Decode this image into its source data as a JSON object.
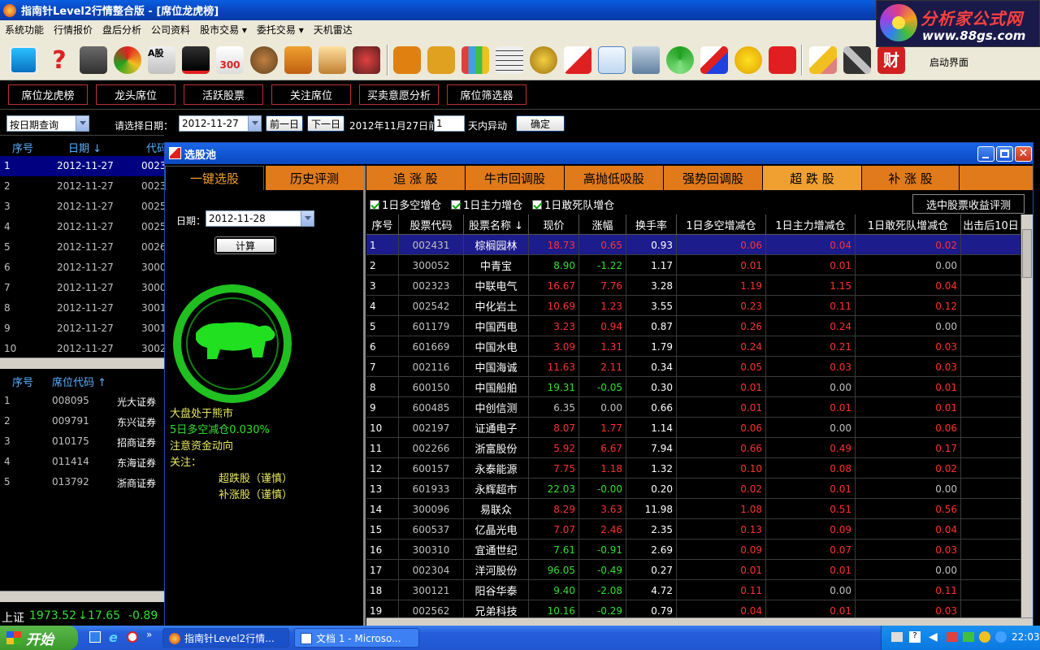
{
  "window_title": "指南针Level2行情整合版 - [席位龙虎榜]",
  "logo": {
    "line1": "分析家公式网",
    "line2": "www.88gs.com"
  },
  "menu": [
    "系统功能",
    "行情报价",
    "盘后分析",
    "公司资料",
    "股市交易 ▾",
    "委托交易 ▾",
    "天机雷达"
  ],
  "toolbar": {
    "start_label": "启动界面"
  },
  "nav_tabs": [
    "席位龙虎榜",
    "龙头席位",
    "活跃股票",
    "关注席位",
    "买卖意愿分析",
    "席位筛选器"
  ],
  "query": {
    "mode": "按日期查询",
    "date_label": "请选择日期：",
    "date": "2012-11-27",
    "prev": "前一日",
    "next": "下一日",
    "before_text": "2012年11月27日前",
    "days": "1",
    "days_suffix": "天内异动",
    "confirm": "确定"
  },
  "left_top": {
    "headers": [
      "序号",
      "日期 ↓",
      "代码"
    ],
    "rows": [
      {
        "no": "1",
        "date": "2012-11-27",
        "code": "0023"
      },
      {
        "no": "2",
        "date": "2012-11-27",
        "code": "0023"
      },
      {
        "no": "3",
        "date": "2012-11-27",
        "code": "0025"
      },
      {
        "no": "4",
        "date": "2012-11-27",
        "code": "0025"
      },
      {
        "no": "5",
        "date": "2012-11-27",
        "code": "0026"
      },
      {
        "no": "6",
        "date": "2012-11-27",
        "code": "3000"
      },
      {
        "no": "7",
        "date": "2012-11-27",
        "code": "3000"
      },
      {
        "no": "8",
        "date": "2012-11-27",
        "code": "3001"
      },
      {
        "no": "9",
        "date": "2012-11-27",
        "code": "3001"
      },
      {
        "no": "10",
        "date": "2012-11-27",
        "code": "3002"
      }
    ]
  },
  "left_bottom": {
    "headers": [
      "序号",
      "席位代码 ↑"
    ],
    "rows": [
      {
        "no": "1",
        "code": "008095",
        "name": "光大证券"
      },
      {
        "no": "2",
        "code": "009791",
        "name": "东兴证券"
      },
      {
        "no": "3",
        "code": "010175",
        "name": "招商证券"
      },
      {
        "no": "4",
        "code": "011414",
        "name": "东海证券"
      },
      {
        "no": "5",
        "code": "013792",
        "name": "浙商证券"
      }
    ]
  },
  "status": {
    "index": "上证",
    "value": "1973.52",
    "arrow": "↓",
    "change": "17.65",
    "pct": "-0.89"
  },
  "dialog": {
    "title": "选股池",
    "left_tabs": [
      "一键选股",
      "历史评测"
    ],
    "date_label": "日期：",
    "date": "2012-11-28",
    "calc": "计算",
    "market_lines": [
      "大盘处于熊市",
      "5日多空减仓0.030%",
      "注意资金动向",
      "关注："
    ],
    "focus": [
      "超跌股（谨慎）",
      "补涨股（谨慎）"
    ],
    "filter_tabs": [
      "追 涨 股",
      "牛市回调股",
      "高抛低吸股",
      "强势回调股",
      "超 跌 股",
      "补 涨 股"
    ],
    "active_filter": 4,
    "checks": [
      "1日多空增仓",
      "1日主力增仓",
      "1日敢死队增仓"
    ],
    "eval_button": "选中股票收益评测",
    "columns": [
      "序号",
      "股票代码",
      "股票名称 ↓",
      "现价",
      "涨幅",
      "换手率",
      "1日多空增减仓",
      "1日主力增减仓",
      "1日敢死队增减仓",
      "出击后10日"
    ],
    "rows": [
      [
        "1",
        "002431",
        "棕榈园林",
        "18.73",
        "0.65",
        "0.93",
        "0.06",
        "0.04",
        "0.02"
      ],
      [
        "2",
        "300052",
        "中青宝",
        "8.90",
        "-1.22",
        "1.17",
        "0.01",
        "0.01",
        "0.00"
      ],
      [
        "3",
        "002323",
        "中联电气",
        "16.67",
        "7.76",
        "3.28",
        "1.19",
        "1.15",
        "0.04"
      ],
      [
        "4",
        "002542",
        "中化岩土",
        "10.69",
        "1.23",
        "3.55",
        "0.23",
        "0.11",
        "0.12"
      ],
      [
        "5",
        "601179",
        "中国西电",
        "3.23",
        "0.94",
        "0.87",
        "0.26",
        "0.24",
        "0.00"
      ],
      [
        "6",
        "601669",
        "中国水电",
        "3.09",
        "1.31",
        "1.79",
        "0.24",
        "0.21",
        "0.03"
      ],
      [
        "7",
        "002116",
        "中国海诚",
        "11.63",
        "2.11",
        "0.34",
        "0.05",
        "0.03",
        "0.03"
      ],
      [
        "8",
        "600150",
        "中国船舶",
        "19.31",
        "-0.05",
        "0.30",
        "0.01",
        "0.00",
        "0.01"
      ],
      [
        "9",
        "600485",
        "中创信测",
        "6.35",
        "0.00",
        "0.66",
        "0.01",
        "0.01",
        "0.01"
      ],
      [
        "10",
        "002197",
        "证通电子",
        "8.07",
        "1.77",
        "1.14",
        "0.06",
        "0.00",
        "0.06"
      ],
      [
        "11",
        "002266",
        "浙富股份",
        "5.92",
        "6.67",
        "7.94",
        "0.66",
        "0.49",
        "0.17"
      ],
      [
        "12",
        "600157",
        "永泰能源",
        "7.75",
        "1.18",
        "1.32",
        "0.10",
        "0.08",
        "0.02"
      ],
      [
        "13",
        "601933",
        "永辉超市",
        "22.03",
        "-0.00",
        "0.20",
        "0.02",
        "0.01",
        "0.00"
      ],
      [
        "14",
        "300096",
        "易联众",
        "8.29",
        "3.63",
        "11.98",
        "1.08",
        "0.51",
        "0.56"
      ],
      [
        "15",
        "600537",
        "亿晶光电",
        "7.07",
        "2.46",
        "2.35",
        "0.13",
        "0.09",
        "0.04"
      ],
      [
        "16",
        "300310",
        "宜通世纪",
        "7.61",
        "-0.91",
        "2.69",
        "0.09",
        "0.07",
        "0.03"
      ],
      [
        "17",
        "002304",
        "洋河股份",
        "96.05",
        "-0.49",
        "0.27",
        "0.01",
        "0.01",
        "0.00"
      ],
      [
        "18",
        "300121",
        "阳谷华泰",
        "9.40",
        "-2.08",
        "4.72",
        "0.11",
        "0.00",
        "0.11"
      ],
      [
        "19",
        "002562",
        "兄弟科技",
        "10.16",
        "-0.29",
        "0.79",
        "0.04",
        "0.01",
        "0.03"
      ]
    ]
  },
  "taskbar": {
    "start": "开始",
    "tasks": [
      "指南针Level2行情...",
      "文档 1 - Microso..."
    ],
    "clock": "22:03"
  },
  "colors": {
    "up": "#ff3030",
    "down": "#30e030",
    "cyan": "#5ab0ff",
    "yellow": "#e8e860",
    "orange_tab": "#e07a1a"
  }
}
